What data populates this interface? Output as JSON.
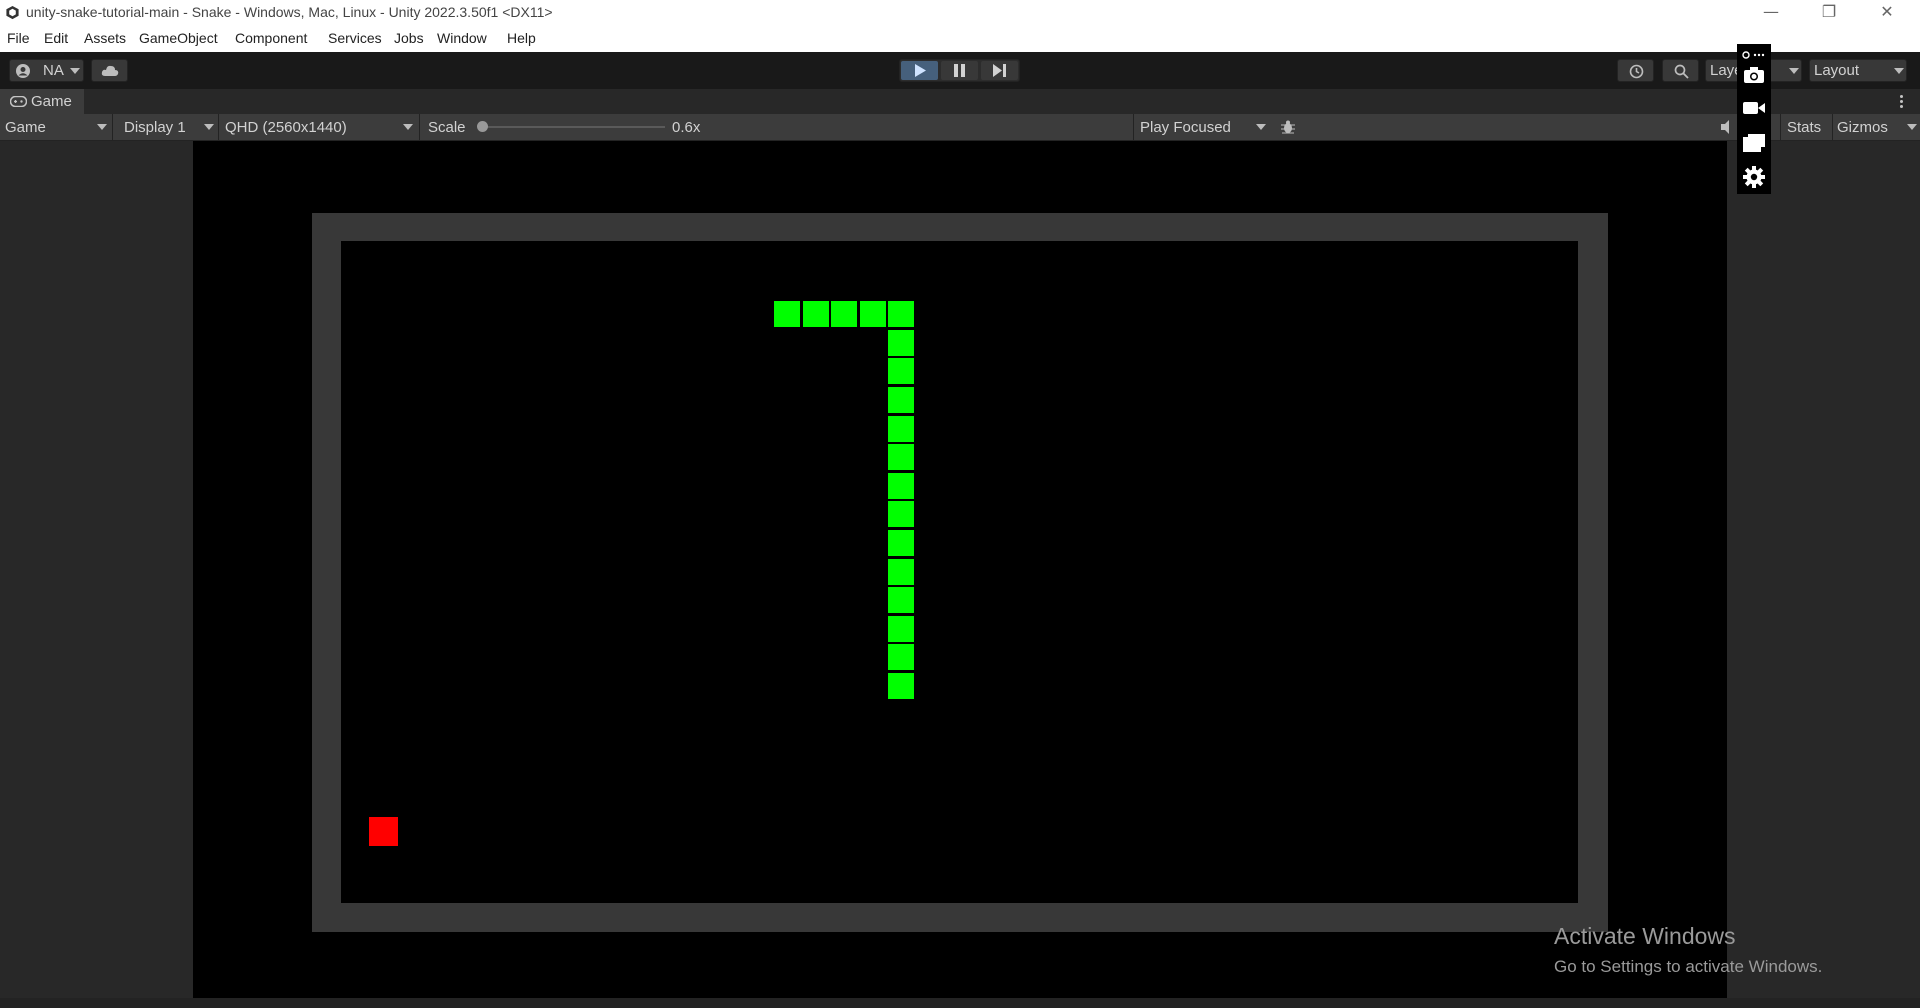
{
  "window": {
    "title": "unity-snake-tutorial-main - Snake - Windows, Mac, Linux - Unity 2022.3.50f1 <DX11>",
    "minimize_glyph": "—",
    "restore_glyph": "❐",
    "close_glyph": "✕"
  },
  "menu": {
    "items": [
      "File",
      "Edit",
      "Assets",
      "GameObject",
      "Component",
      "Services",
      "Jobs",
      "Window",
      "Help"
    ]
  },
  "toolbar": {
    "account_label": "NA",
    "layers_label": "Layers",
    "layout_label": "Layout"
  },
  "game_tab": {
    "tab_label": "Game",
    "view_mode": "Game",
    "display": "Display 1",
    "resolution": "QHD (2560x1440)",
    "scale_label": "Scale",
    "scale_value": "0.6x",
    "scale_level": 0.0,
    "play_mode": "Play Focused",
    "stats_label": "Stats",
    "gizmos_label": "Gizmos"
  },
  "game": {
    "snake_color": "#00ff00",
    "food_color": "#ff0000",
    "wall_color": "#383838",
    "snake_cells": [
      [
        15,
        2
      ],
      [
        16,
        2
      ],
      [
        17,
        2
      ],
      [
        18,
        2
      ],
      [
        19,
        2
      ],
      [
        19,
        3
      ],
      [
        19,
        4
      ],
      [
        19,
        5
      ],
      [
        19,
        6
      ],
      [
        19,
        7
      ],
      [
        19,
        8
      ],
      [
        19,
        9
      ],
      [
        19,
        10
      ],
      [
        19,
        11
      ],
      [
        19,
        12
      ],
      [
        19,
        13
      ],
      [
        19,
        14
      ],
      [
        19,
        15
      ]
    ],
    "food_cell": [
      1,
      20
    ]
  },
  "watermark": {
    "title": "Activate Windows",
    "subtitle": "Go to Settings to activate Windows."
  }
}
